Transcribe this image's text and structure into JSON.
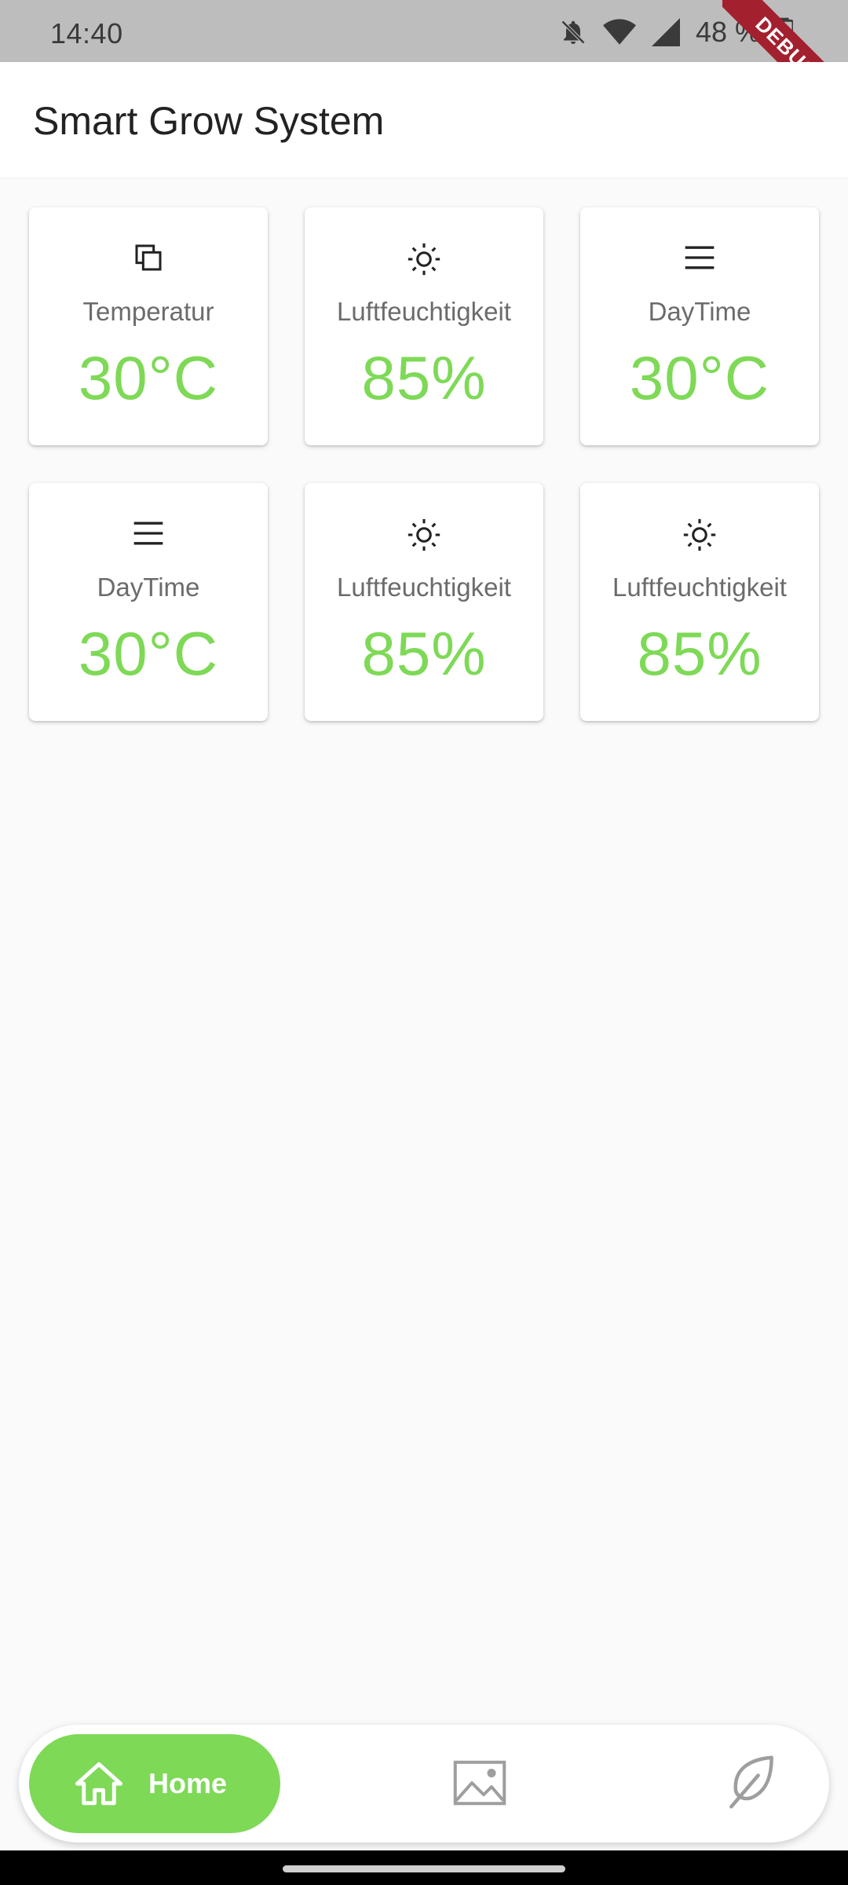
{
  "status_bar": {
    "time": "14:40",
    "battery_percent": "48 %",
    "icons": [
      "notifications-off-icon",
      "wifi-icon",
      "signal-icon",
      "battery-icon"
    ]
  },
  "debug_banner": "DEBUG",
  "app_bar": {
    "title": "Smart Grow System"
  },
  "cards": [
    {
      "icon": "copy-icon",
      "label": "Temperatur",
      "value": "30°C"
    },
    {
      "icon": "sun-icon",
      "label": "Luftfeuchtigkeit",
      "value": "85%"
    },
    {
      "icon": "menu-icon",
      "label": "DayTime",
      "value": "30°C"
    },
    {
      "icon": "menu-icon",
      "label": "DayTime",
      "value": "30°C"
    },
    {
      "icon": "sun-icon",
      "label": "Luftfeuchtigkeit",
      "value": "85%"
    },
    {
      "icon": "sun-icon",
      "label": "Luftfeuchtigkeit",
      "value": "85%"
    }
  ],
  "bottom_nav": {
    "items": [
      {
        "icon": "home-icon",
        "label": "Home",
        "selected": true
      },
      {
        "icon": "image-icon",
        "label": "",
        "selected": false
      },
      {
        "icon": "leaf-icon",
        "label": "",
        "selected": false
      }
    ]
  },
  "colors": {
    "accent": "#7ed957",
    "status_bar": "#bdbdbd",
    "debug": "#a3202e",
    "background": "#fafafa"
  }
}
